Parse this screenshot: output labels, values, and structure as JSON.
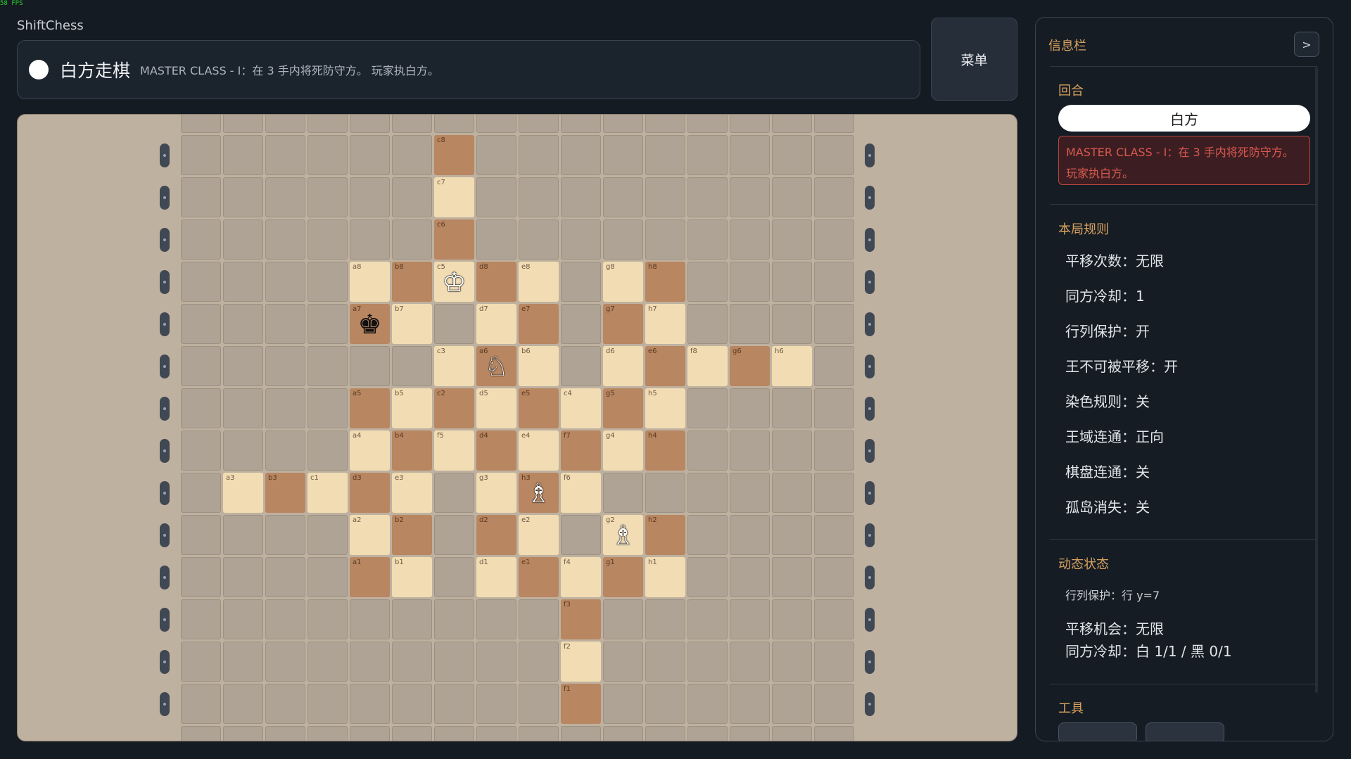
{
  "fps": "58 FPS",
  "app_title": "ShiftChess",
  "turn_bar": {
    "player": "白方走棋",
    "description": "MASTER CLASS - I：在 3 手内将死防守方。 玩家执白方。"
  },
  "menu_label": "菜单",
  "board": {
    "cols": 16,
    "rows": 15,
    "cells": [
      {
        "r": 1,
        "c": 6,
        "label": "c8",
        "shade": "dark"
      },
      {
        "r": 2,
        "c": 6,
        "label": "c7",
        "shade": "light"
      },
      {
        "r": 3,
        "c": 6,
        "label": "c6",
        "shade": "dark"
      },
      {
        "r": 4,
        "c": 4,
        "label": "a8",
        "shade": "light"
      },
      {
        "r": 4,
        "c": 5,
        "label": "b8",
        "shade": "dark"
      },
      {
        "r": 4,
        "c": 6,
        "label": "c5",
        "shade": "light",
        "piece": "white-king"
      },
      {
        "r": 4,
        "c": 7,
        "label": "d8",
        "shade": "dark"
      },
      {
        "r": 4,
        "c": 8,
        "label": "e8",
        "shade": "light"
      },
      {
        "r": 4,
        "c": 10,
        "label": "g8",
        "shade": "light"
      },
      {
        "r": 4,
        "c": 11,
        "label": "h8",
        "shade": "dark"
      },
      {
        "r": 5,
        "c": 4,
        "label": "a7",
        "shade": "dark",
        "piece": "black-king"
      },
      {
        "r": 5,
        "c": 5,
        "label": "b7",
        "shade": "light"
      },
      {
        "r": 5,
        "c": 7,
        "label": "d7",
        "shade": "light"
      },
      {
        "r": 5,
        "c": 8,
        "label": "e7",
        "shade": "dark"
      },
      {
        "r": 5,
        "c": 10,
        "label": "g7",
        "shade": "dark"
      },
      {
        "r": 5,
        "c": 11,
        "label": "h7",
        "shade": "light"
      },
      {
        "r": 6,
        "c": 6,
        "label": "c3",
        "shade": "light"
      },
      {
        "r": 6,
        "c": 7,
        "label": "a6",
        "shade": "dark",
        "piece": "white-knight"
      },
      {
        "r": 6,
        "c": 8,
        "label": "b6",
        "shade": "light"
      },
      {
        "r": 6,
        "c": 10,
        "label": "d6",
        "shade": "light"
      },
      {
        "r": 6,
        "c": 11,
        "label": "e6",
        "shade": "dark"
      },
      {
        "r": 6,
        "c": 12,
        "label": "f8",
        "shade": "light"
      },
      {
        "r": 6,
        "c": 13,
        "label": "g6",
        "shade": "dark"
      },
      {
        "r": 6,
        "c": 14,
        "label": "h6",
        "shade": "light"
      },
      {
        "r": 7,
        "c": 4,
        "label": "a5",
        "shade": "dark"
      },
      {
        "r": 7,
        "c": 5,
        "label": "b5",
        "shade": "light"
      },
      {
        "r": 7,
        "c": 6,
        "label": "c2",
        "shade": "dark"
      },
      {
        "r": 7,
        "c": 7,
        "label": "d5",
        "shade": "light"
      },
      {
        "r": 7,
        "c": 8,
        "label": "e5",
        "shade": "dark"
      },
      {
        "r": 7,
        "c": 9,
        "label": "c4",
        "shade": "light"
      },
      {
        "r": 7,
        "c": 10,
        "label": "g5",
        "shade": "dark"
      },
      {
        "r": 7,
        "c": 11,
        "label": "h5",
        "shade": "light"
      },
      {
        "r": 8,
        "c": 4,
        "label": "a4",
        "shade": "light"
      },
      {
        "r": 8,
        "c": 5,
        "label": "b4",
        "shade": "dark"
      },
      {
        "r": 8,
        "c": 6,
        "label": "f5",
        "shade": "light"
      },
      {
        "r": 8,
        "c": 7,
        "label": "d4",
        "shade": "dark"
      },
      {
        "r": 8,
        "c": 8,
        "label": "e4",
        "shade": "light"
      },
      {
        "r": 8,
        "c": 9,
        "label": "f7",
        "shade": "dark"
      },
      {
        "r": 8,
        "c": 10,
        "label": "g4",
        "shade": "light"
      },
      {
        "r": 8,
        "c": 11,
        "label": "h4",
        "shade": "dark"
      },
      {
        "r": 9,
        "c": 1,
        "label": "a3",
        "shade": "light"
      },
      {
        "r": 9,
        "c": 2,
        "label": "b3",
        "shade": "dark"
      },
      {
        "r": 9,
        "c": 3,
        "label": "c1",
        "shade": "light"
      },
      {
        "r": 9,
        "c": 4,
        "label": "d3",
        "shade": "dark"
      },
      {
        "r": 9,
        "c": 5,
        "label": "e3",
        "shade": "light"
      },
      {
        "r": 9,
        "c": 7,
        "label": "g3",
        "shade": "light"
      },
      {
        "r": 9,
        "c": 8,
        "label": "h3",
        "shade": "dark",
        "piece": "white-bishop"
      },
      {
        "r": 9,
        "c": 9,
        "label": "f6",
        "shade": "light"
      },
      {
        "r": 10,
        "c": 4,
        "label": "a2",
        "shade": "light"
      },
      {
        "r": 10,
        "c": 5,
        "label": "b2",
        "shade": "dark"
      },
      {
        "r": 10,
        "c": 7,
        "label": "d2",
        "shade": "dark"
      },
      {
        "r": 10,
        "c": 8,
        "label": "e2",
        "shade": "light"
      },
      {
        "r": 10,
        "c": 10,
        "label": "g2",
        "shade": "light",
        "piece": "white-bishop"
      },
      {
        "r": 10,
        "c": 11,
        "label": "h2",
        "shade": "dark"
      },
      {
        "r": 11,
        "c": 4,
        "label": "a1",
        "shade": "dark"
      },
      {
        "r": 11,
        "c": 5,
        "label": "b1",
        "shade": "light"
      },
      {
        "r": 11,
        "c": 7,
        "label": "d1",
        "shade": "light"
      },
      {
        "r": 11,
        "c": 8,
        "label": "e1",
        "shade": "dark"
      },
      {
        "r": 11,
        "c": 9,
        "label": "f4",
        "shade": "light"
      },
      {
        "r": 11,
        "c": 10,
        "label": "g1",
        "shade": "dark"
      },
      {
        "r": 11,
        "c": 11,
        "label": "h1",
        "shade": "light"
      },
      {
        "r": 12,
        "c": 9,
        "label": "f3",
        "shade": "dark"
      },
      {
        "r": 13,
        "c": 9,
        "label": "f2",
        "shade": "light"
      },
      {
        "r": 14,
        "c": 9,
        "label": "f1",
        "shade": "dark"
      }
    ]
  },
  "sidebar": {
    "title": "信息栏",
    "toggle_label": ">",
    "round_label": "回合",
    "current_turn": "白方",
    "puzzle_text": "MASTER CLASS - I：在 3 手内将死防守方。玩家执白方。",
    "rules_label": "本局规则",
    "rules": [
      "平移次数：无限",
      "同方冷却：1",
      "行列保护：开",
      "王不可被平移：开",
      "染色规则：关",
      "王域连通：正向",
      "棋盘连通：关",
      "孤岛消失：关"
    ],
    "status_label": "动态状态",
    "status_protect": "行列保护：行 y=7",
    "status_shifts": "平移机会：无限",
    "status_cooldown": "同方冷却：白 1/1 / 黑 0/1",
    "tools_label": "工具"
  }
}
